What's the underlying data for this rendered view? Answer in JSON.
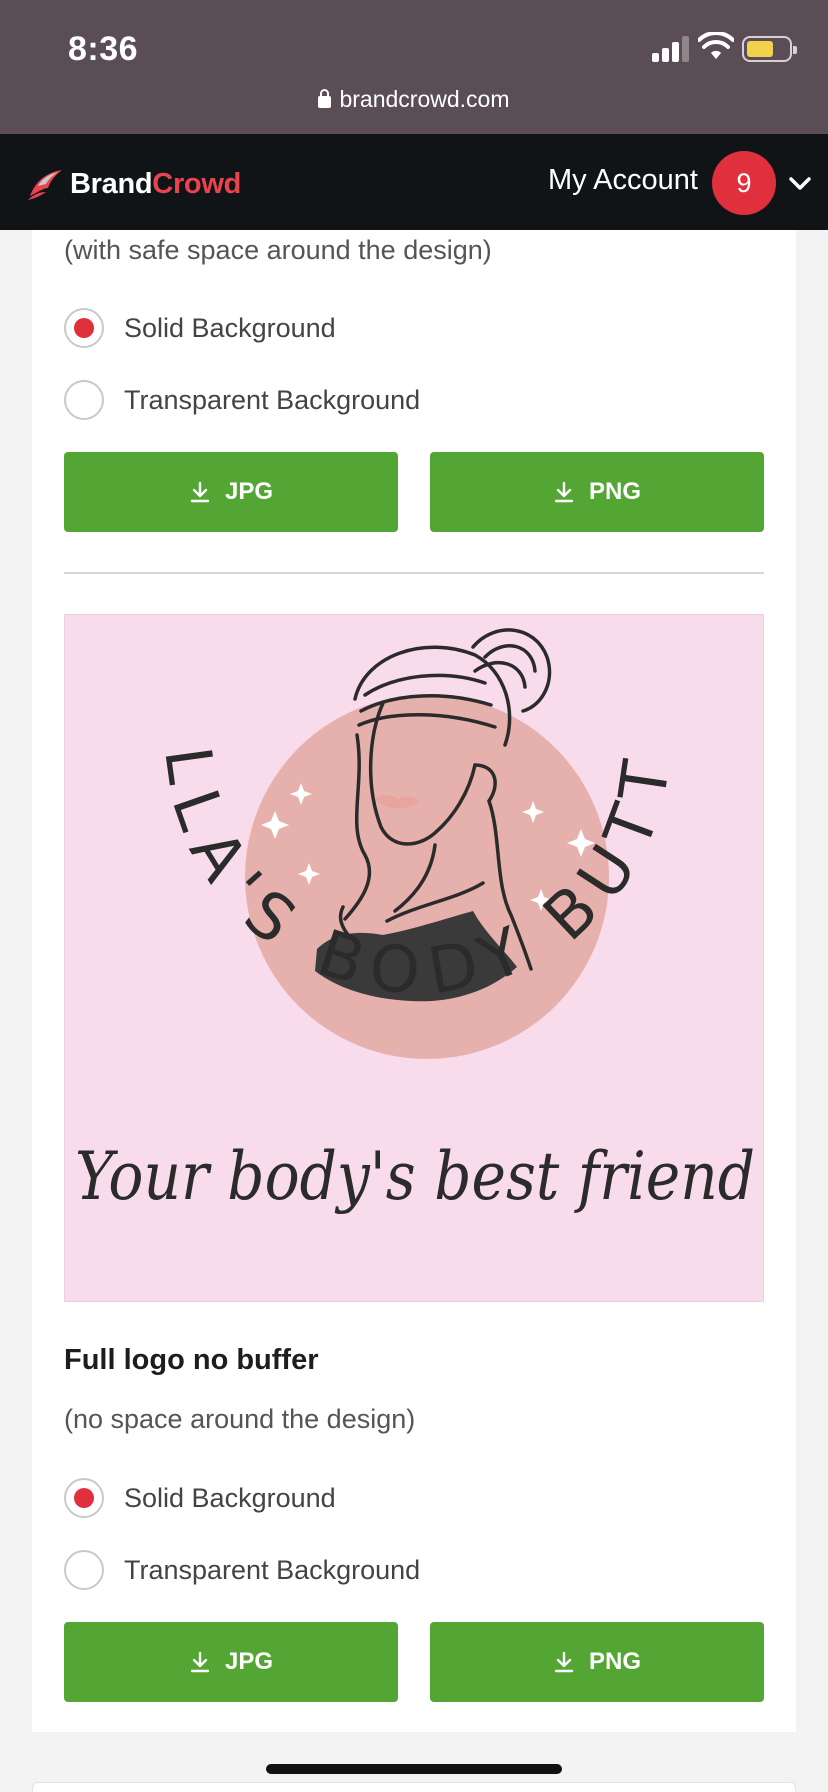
{
  "status_bar": {
    "time": "8:36",
    "url": "brandcrowd.com"
  },
  "header": {
    "brand": "Brand",
    "brand_accent": "Crowd",
    "account_label": "My Account",
    "notification_count": "9"
  },
  "option_a": {
    "subtitle": "(with safe space around the design)",
    "radios": [
      {
        "label": "Solid Background",
        "selected": true
      },
      {
        "label": "Transparent Background",
        "selected": false
      }
    ],
    "jpg_label": "JPG",
    "png_label": "PNG"
  },
  "logo_preview": {
    "arc_text": "BELLA'S BODY BUTTER",
    "tagline": "Your body's best friend"
  },
  "option_b": {
    "title": "Full logo no buffer",
    "subtitle": "(no space around the design)",
    "radios": [
      {
        "label": "Solid Background",
        "selected": true
      },
      {
        "label": "Transparent Background",
        "selected": false
      }
    ],
    "jpg_label": "JPG",
    "png_label": "PNG"
  },
  "colors": {
    "accent_red": "#e0303e",
    "download_green": "#53a633",
    "preview_pink": "#f9dcec",
    "circle_pink": "#e6b1ad"
  },
  "icons": [
    "lock-icon",
    "cellular-signal-icon",
    "wifi-icon",
    "battery-icon",
    "brandcrowd-logo-icon",
    "chevron-down-icon",
    "download-icon"
  ]
}
